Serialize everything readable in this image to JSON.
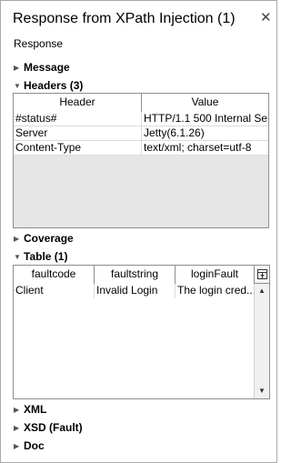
{
  "window": {
    "title": "Response from XPath Injection (1)",
    "close_glyph": "✕",
    "subtitle": "Response"
  },
  "sections": {
    "message": "Message",
    "headers": "Headers (3)",
    "coverage": "Coverage",
    "table": "Table (1)",
    "xml": "XML",
    "xsd": "XSD (Fault)",
    "doc": "Doc"
  },
  "headers_table": {
    "columns": [
      "Header",
      "Value"
    ],
    "rows": [
      [
        "#status#",
        "HTTP/1.1 500 Internal Se..."
      ],
      [
        "Server",
        "Jetty(6.1.26)"
      ],
      [
        "Content-Type",
        "text/xml; charset=utf-8"
      ]
    ]
  },
  "result_table": {
    "columns": [
      "faultcode",
      "faultstring",
      "loginFault"
    ],
    "rows": [
      [
        "Client",
        "Invalid Login",
        "The login cred..."
      ]
    ]
  },
  "icons": {
    "collapsed": "chevron-right-icon",
    "expanded": "chevron-down-icon",
    "column_picker": "column-chooser-icon"
  }
}
